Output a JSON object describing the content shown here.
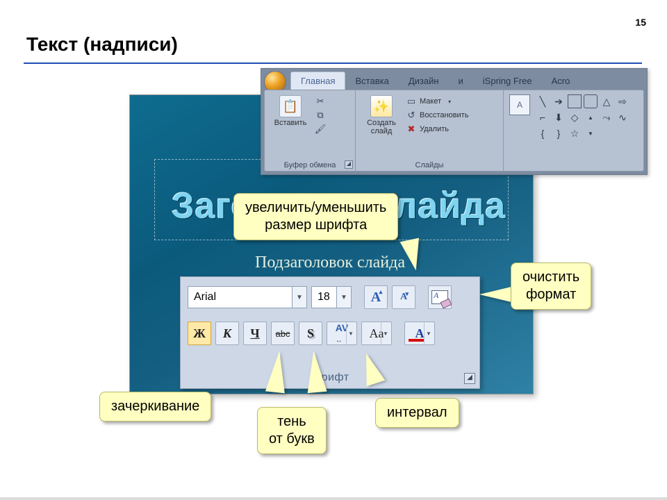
{
  "page": {
    "number": "15",
    "title": "Текст (надписи)"
  },
  "pp_slide": {
    "title_text": "Заголовок слайда",
    "subtitle_text": "Подзаголовок слайда"
  },
  "ribbon": {
    "tabs": {
      "home": "Главная",
      "insert": "Вставка",
      "design": "Дизайн",
      "i": "и",
      "ispring": "iSpring Free",
      "acro": "Acro"
    },
    "group_clipboard": {
      "paste_label": "Вставить",
      "group_label": "Буфер обмена"
    },
    "group_slides": {
      "new_slide_label": "Создать\nслайд",
      "layout_label": "Макет",
      "reset_label": "Восстановить",
      "delete_label": "Удалить",
      "group_label": "Слайды"
    }
  },
  "callouts": {
    "grow_shrink": "увеличить/уменьшить\nразмер шрифта",
    "clear_format": "очистить\nформат",
    "strikethrough": "зачеркивание",
    "text_shadow": "тень\nот букв",
    "char_spacing": "интервал"
  },
  "font_panel": {
    "font_name": "Arial",
    "font_size": "18",
    "group_label": "Шрифт",
    "buttons": {
      "grow_font_glyph": "A",
      "shrink_font_glyph": "A",
      "bold_glyph": "Ж",
      "italic_glyph": "К",
      "underline_glyph": "Ч",
      "strike_glyph": "abc",
      "shadow_glyph": "S",
      "spacing_glyph": "AV",
      "case_glyph": "Aa",
      "font_color_glyph": "A"
    }
  }
}
